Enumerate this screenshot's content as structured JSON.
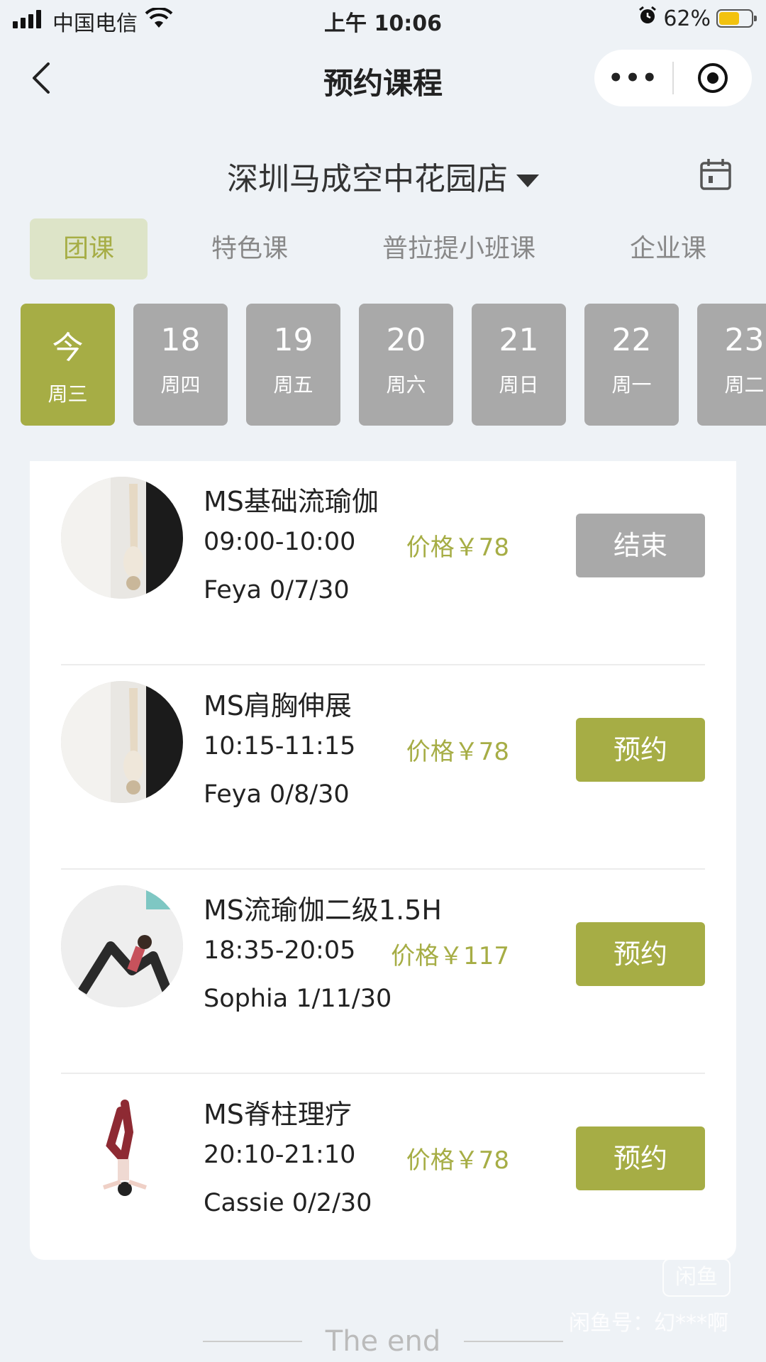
{
  "status_bar": {
    "carrier": "中国电信",
    "time": "上午 10:06",
    "battery_percent": "62%"
  },
  "navbar": {
    "title": "预约课程",
    "more_label": "•••"
  },
  "store": {
    "name": "深圳马成空中花园店"
  },
  "category_tabs": [
    {
      "label": "团课",
      "active": true
    },
    {
      "label": "特色课",
      "active": false
    },
    {
      "label": "普拉提小班课",
      "active": false
    },
    {
      "label": "企业课",
      "active": false
    }
  ],
  "dates": [
    {
      "num": "今",
      "weekday": "周三",
      "active": true
    },
    {
      "num": "18",
      "weekday": "周四",
      "active": false
    },
    {
      "num": "19",
      "weekday": "周五",
      "active": false
    },
    {
      "num": "20",
      "weekday": "周六",
      "active": false
    },
    {
      "num": "21",
      "weekday": "周日",
      "active": false
    },
    {
      "num": "22",
      "weekday": "周一",
      "active": false
    },
    {
      "num": "23",
      "weekday": "周二",
      "active": false
    }
  ],
  "courses": [
    {
      "name": "MS基础流瑜伽",
      "time": "09:00-10:00",
      "price": "价格￥78",
      "teacher": "Feya 0/7/30",
      "button": "结束",
      "status": "ended"
    },
    {
      "name": "MS肩胸伸展",
      "time": "10:15-11:15",
      "price": "价格￥78",
      "teacher": "Feya 0/8/30",
      "button": "预约",
      "status": "book"
    },
    {
      "name": "MS流瑜伽二级1.5H",
      "time": "18:35-20:05",
      "price": "价格￥117",
      "teacher": "Sophia 1/11/30",
      "button": "预约",
      "status": "book"
    },
    {
      "name": "MS脊柱理疗",
      "time": "20:10-21:10",
      "price": "价格￥78",
      "teacher": "Cassie 0/2/30",
      "button": "预约",
      "status": "book"
    }
  ],
  "footer": {
    "end_text": "The end",
    "watermark": "闲鱼号：幻***啊",
    "watermark_logo": "闲鱼"
  },
  "colors": {
    "accent": "#a6ad45",
    "inactive": "#a9a9a9",
    "tab_active_bg": "#dde4c8",
    "background": "#eef2f6"
  }
}
